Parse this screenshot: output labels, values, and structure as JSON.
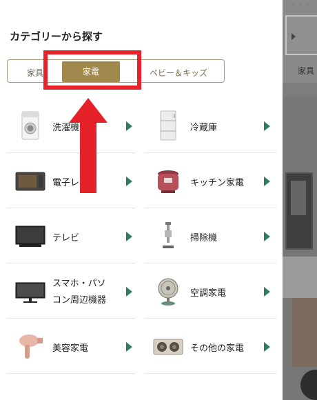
{
  "background": {
    "tab_label": "家具"
  },
  "menu": {
    "title": "カテゴリーから探す",
    "tabs": {
      "left": "家具",
      "active": "家電",
      "right": "ベビー＆キッズ"
    },
    "categories": [
      {
        "label": "洗濯機",
        "icon": "washing-machine-icon"
      },
      {
        "label": "冷蔵庫",
        "icon": "refrigerator-icon"
      },
      {
        "label": "電子レンジ",
        "icon": "microwave-icon"
      },
      {
        "label": "キッチン家電",
        "icon": "rice-cooker-icon"
      },
      {
        "label": "テレビ",
        "icon": "tv-icon"
      },
      {
        "label": "掃除機",
        "icon": "vacuum-icon"
      },
      {
        "label_line1": "スマホ・パソ",
        "label_line2": "コン周辺機器",
        "icon": "monitor-icon"
      },
      {
        "label": "空調家電",
        "icon": "fan-icon"
      },
      {
        "label": "美容家電",
        "icon": "hair-dryer-icon"
      },
      {
        "label": "その他の家電",
        "icon": "radio-icon"
      }
    ]
  },
  "annotation": {
    "highlight_color": "#e52229"
  },
  "colors": {
    "accent_gold": "#a1884d",
    "arrow_green": "#2f7d61"
  }
}
